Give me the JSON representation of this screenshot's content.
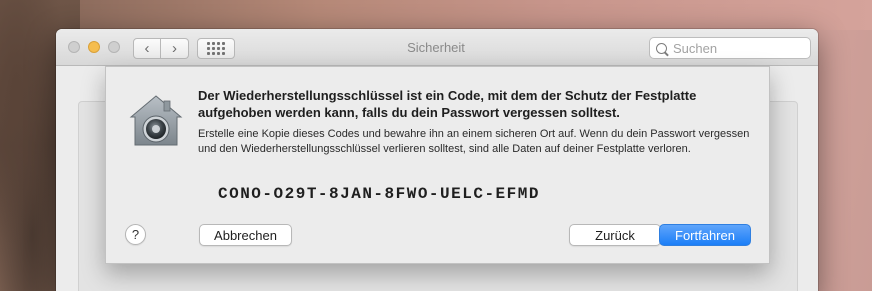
{
  "window": {
    "title": "Sicherheit"
  },
  "toolbar": {
    "back_icon": "chevron-left-icon",
    "forward_icon": "chevron-right-icon",
    "grid_icon": "grid-icon"
  },
  "search": {
    "placeholder": "Suchen",
    "value": ""
  },
  "sheet": {
    "icon": "filevault-lock-icon",
    "headline": "Der Wiederherstellungsschlüssel ist ein Code, mit dem der Schutz der Festplatte aufgehoben werden kann, falls du dein Passwort vergessen solltest.",
    "body": "Erstelle eine Kopie dieses Codes und bewahre ihn an einem sicheren Ort auf. Wenn du dein Passwort vergessen und den Wiederherstellungsschlüssel verlieren solltest, sind alle Daten auf deiner Festplatte verloren.",
    "recovery_key": "CONO-O29T-8JAN-8FWO-UELC-EFMD",
    "help_label": "?",
    "cancel_label": "Abbrechen",
    "back_label": "Zurück",
    "continue_label": "Fortfahren"
  },
  "colors": {
    "accent": "#1b7ef7",
    "traffic_minimize": "#f5bd4f"
  }
}
